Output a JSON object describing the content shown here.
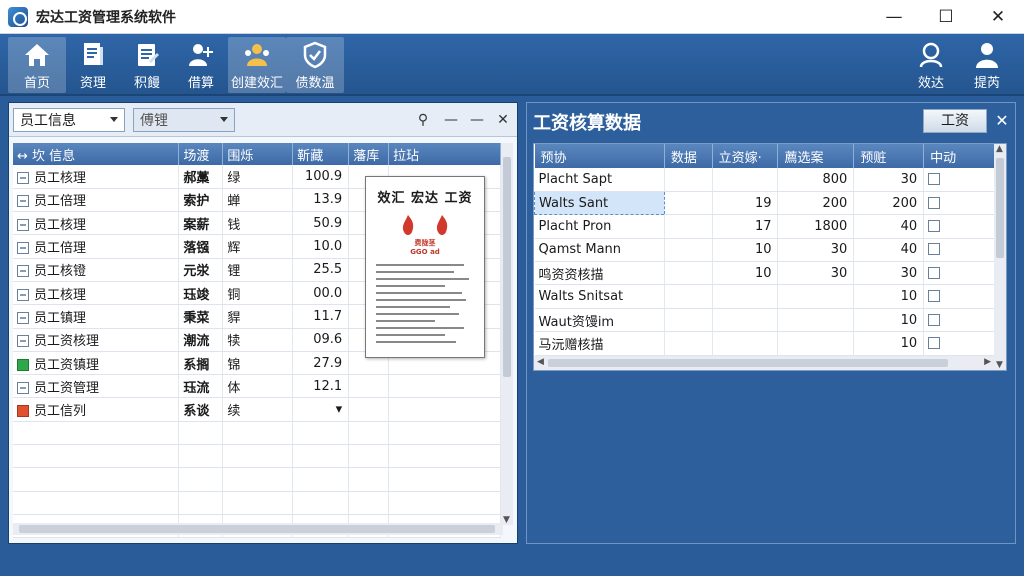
{
  "window": {
    "title": "宏达工资管理系统软件",
    "minimize": "—",
    "maximize": "☐",
    "close": "✕"
  },
  "toolbar": {
    "items": [
      {
        "label": "首页",
        "icon": "home-icon"
      },
      {
        "label": "资理",
        "icon": "document-icon"
      },
      {
        "label": "积饅",
        "icon": "clipboard-icon"
      },
      {
        "label": "借算",
        "icon": "add-user-icon"
      },
      {
        "label": "创建效汇",
        "icon": "people-icon"
      },
      {
        "label": "债数温",
        "icon": "shield-icon"
      }
    ],
    "right_items": [
      {
        "label": "效达",
        "icon": "search-user-icon"
      },
      {
        "label": "提芮",
        "icon": "user-icon"
      }
    ]
  },
  "left_panel": {
    "combo1": "员工信息",
    "combo2": "傅锂",
    "columns": [
      "↔ 坎  信息",
      "场渡",
      "围烁",
      "靳藏",
      "藩库",
      "拉玷"
    ],
    "rows": [
      {
        "check": "plain",
        "name": "员工核理",
        "c2": "郝藁",
        "c3": "绿",
        "value": "100.9"
      },
      {
        "check": "plain",
        "name": "员工倍理",
        "c2": "索护",
        "c3": "蝉",
        "value": "13.9"
      },
      {
        "check": "plain",
        "name": "员工核理",
        "c2": "案薪",
        "c3": "钱",
        "value": "50.9"
      },
      {
        "check": "plain",
        "name": "员工倍理",
        "c2": "落镪",
        "c3": "辉",
        "value": "10.0"
      },
      {
        "check": "plain",
        "name": "员工核镫",
        "c2": "元泶",
        "c3": "锂",
        "value": "25.5"
      },
      {
        "check": "plain",
        "name": "员工核理",
        "c2": "珏竣",
        "c3": "铜",
        "value": "00.0"
      },
      {
        "check": "plain",
        "name": "员工镇理",
        "c2": "秉菜",
        "c3": "貋",
        "value": "11.7"
      },
      {
        "check": "plain",
        "name": "员工资核理",
        "c2": "潮流",
        "c3": "犊",
        "value": "09.6"
      },
      {
        "check": "green",
        "name": "员工资镇理",
        "c2": "系搁",
        "c3": "锦",
        "value": "27.9"
      },
      {
        "check": "plain",
        "name": "员工资管理",
        "c2": "珏流",
        "c3": "体",
        "value": "12.1"
      },
      {
        "check": "red",
        "name": "员工信列",
        "c2": "系谈",
        "c3": "续",
        "value": "▾"
      }
    ],
    "doc": {
      "title": "效汇 宏达 工资",
      "sub1": "费陇茎",
      "sub2": "GGO ad"
    }
  },
  "right_panel": {
    "title": "工资核算数据",
    "button": "工资",
    "close": "✕",
    "columns": [
      "预协",
      "数据",
      "立资嫁·",
      "薦选案",
      "预赃",
      "中动"
    ],
    "rows": [
      {
        "name": "Placht Sapt",
        "c2": "",
        "c3": "",
        "c4": "800",
        "c5": "30"
      },
      {
        "name": "Walts Sant",
        "c2": "",
        "c3": "19",
        "c4": "200",
        "c5": "200"
      },
      {
        "name": "Placht Pron",
        "c2": "",
        "c3": "17",
        "c4": "1800",
        "c5": "40"
      },
      {
        "name": "Qamst Mann",
        "c2": "",
        "c3": "10",
        "c4": "30",
        "c5": "40"
      },
      {
        "name": "鸣资资核描",
        "c2": "",
        "c3": "10",
        "c4": "30",
        "c5": "30"
      },
      {
        "name": "Walts Snitsat",
        "c2": "",
        "c3": "",
        "c4": "",
        "c5": "10"
      },
      {
        "name": "Waut资馒im",
        "c2": "",
        "c3": "",
        "c4": "",
        "c5": "10"
      },
      {
        "name": "马沅赠核描",
        "c2": "",
        "c3": "",
        "c4": "",
        "c5": "10"
      }
    ]
  }
}
